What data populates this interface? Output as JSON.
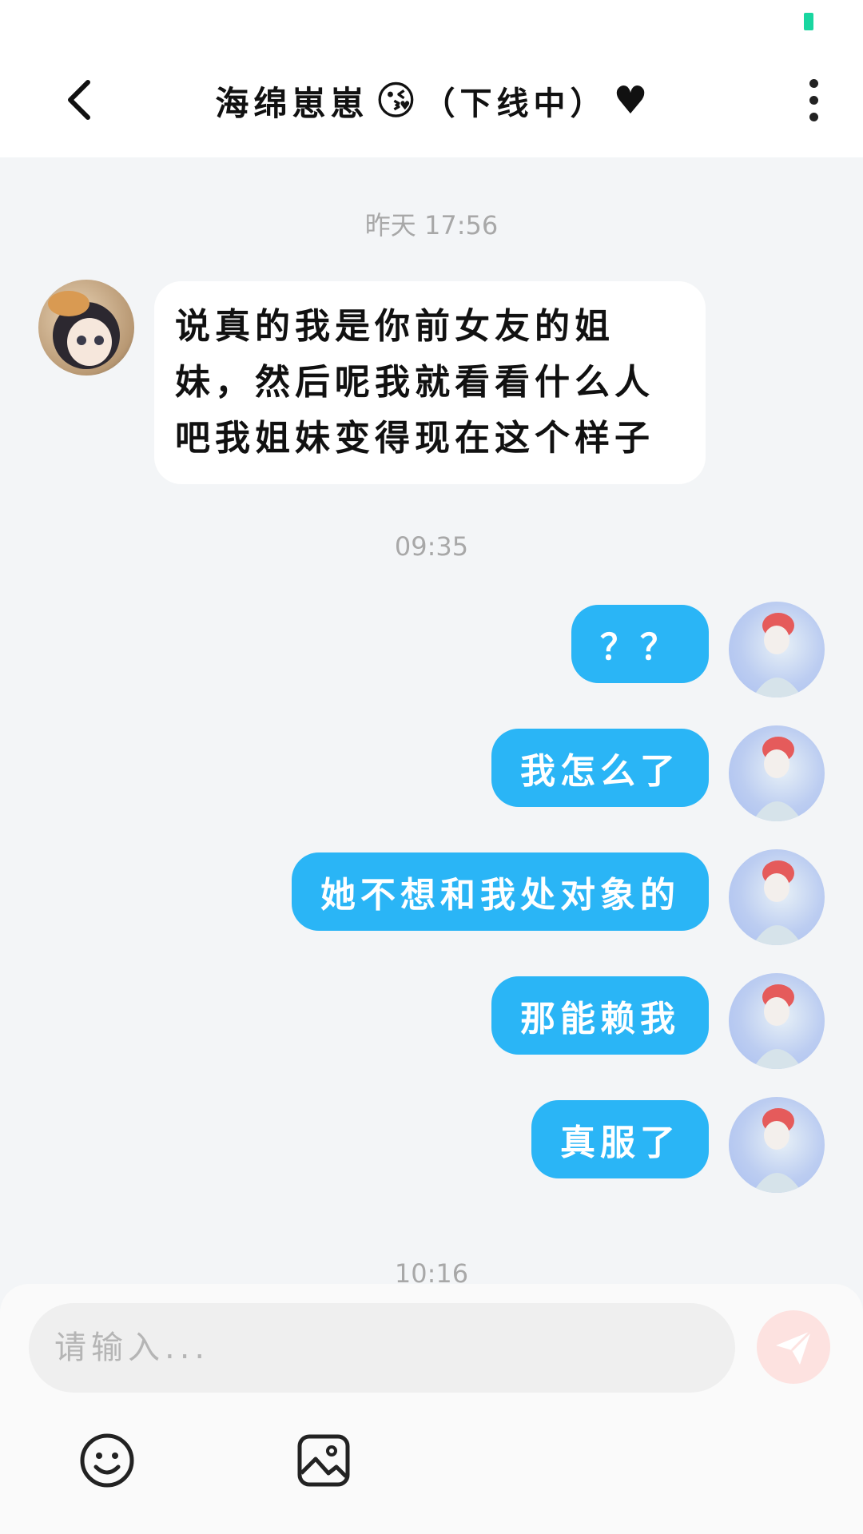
{
  "header": {
    "title_name": "海绵崽崽",
    "title_emoji": "😘",
    "title_status": "（下线中）",
    "title_heart": "♥"
  },
  "chat": {
    "timestamps": [
      "昨天 17:56",
      "09:35",
      "10:16"
    ],
    "incoming": [
      {
        "text": "说真的我是你前女友的姐妹，然后呢我就看看什么人吧我姐妹变得现在这个样子"
      }
    ],
    "outgoing": [
      {
        "text": "？？"
      },
      {
        "text": "我怎么了"
      },
      {
        "text": "她不想和我处对象的"
      },
      {
        "text": "那能赖我"
      },
      {
        "text": "真服了"
      }
    ]
  },
  "composer": {
    "placeholder": "请输入..."
  },
  "colors": {
    "accent": "#2ab5f6",
    "background": "#f3f5f7",
    "send_button": "#fde2e0"
  },
  "icons": {
    "back": "back-arrow-icon",
    "more": "more-vertical-icon",
    "send": "send-icon",
    "emoji": "smiley-icon",
    "image": "image-icon"
  }
}
